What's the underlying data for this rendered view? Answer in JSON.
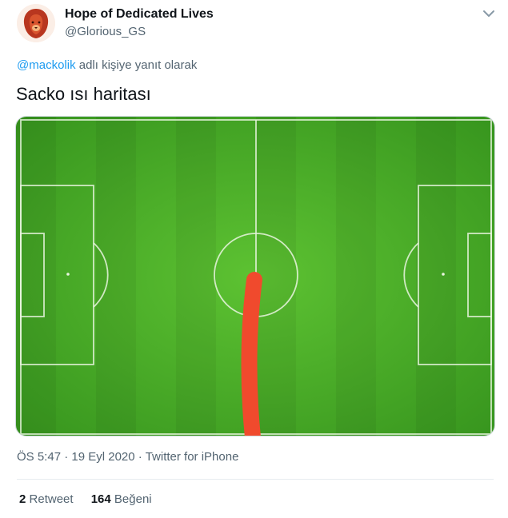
{
  "tweet": {
    "author": {
      "display_name": "Hope of Dedicated Lives",
      "handle": "@Glorious_GS",
      "avatar_icon": "lion-icon"
    },
    "menu_icon": "chevron-down-icon",
    "reply_to": {
      "mention": "@mackolik",
      "suffix": " adlı kişiye yanıt olarak"
    },
    "text": "Sacko ısı haritası",
    "media": {
      "description_icon": "football-pitch-heatmap",
      "pitch_color": "#4caf28",
      "heat_color": "#f04a2d"
    },
    "meta": {
      "time": "ÖS 5:47",
      "separator": " · ",
      "date": "19 Eyl 2020",
      "source": "Twitter for iPhone"
    },
    "stats": {
      "retweet_count": "2",
      "retweet_label": "Retweet",
      "like_count": "164",
      "like_label": "Beğeni"
    },
    "colors": {
      "link": "#1d9bf0",
      "secondary_text": "#536471",
      "primary_text": "#0f1419"
    }
  }
}
